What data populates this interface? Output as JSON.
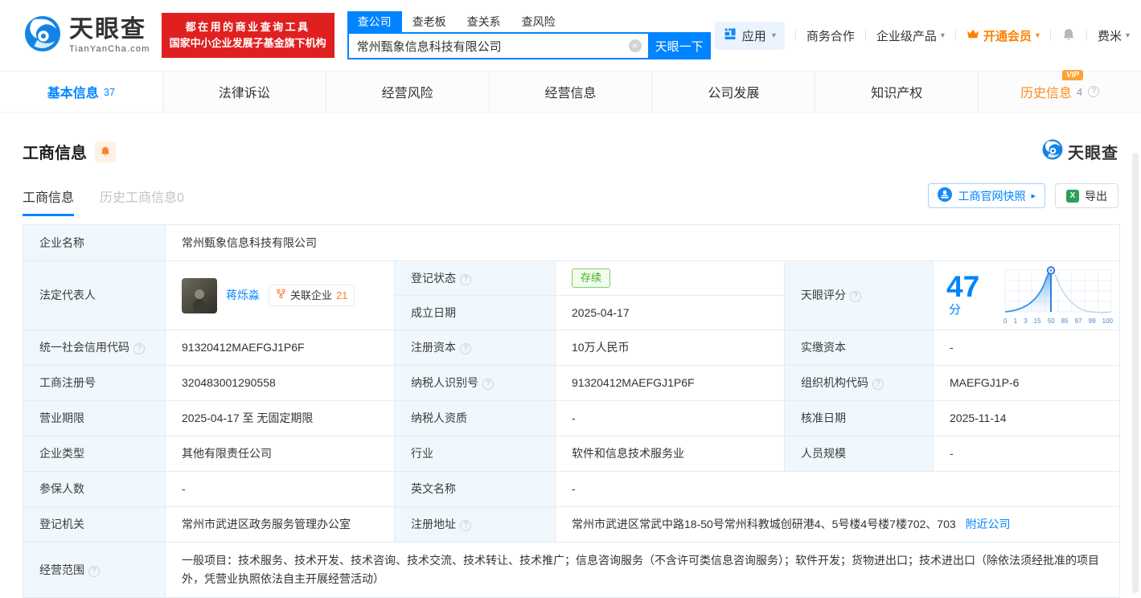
{
  "colors": {
    "primary_blue": "#0084ff",
    "promo_red": "#e02020",
    "vip_orange": "#ff8000",
    "status_green": "#48ab22"
  },
  "icons": {
    "clear": "×",
    "caret": "▾",
    "arrow_right": "▸",
    "question": "?",
    "excel_x": "X"
  },
  "header": {
    "brand": "天眼查",
    "brand_domain": "TianYanCha.com",
    "promo_line1": "都在用的商业查询工具",
    "promo_line2": "国家中小企业发展子基金旗下机构",
    "search_tabs": [
      {
        "label": "查公司"
      },
      {
        "label": "查老板"
      },
      {
        "label": "查关系"
      },
      {
        "label": "查风险"
      }
    ],
    "search_value": "常州甄象信息科技有限公司",
    "search_button": "天眼一下",
    "nav_apps": "应用",
    "nav_cooperation": "商务合作",
    "nav_enterprise": "企业级产品",
    "nav_vip": "开通会员",
    "nav_user": "费米"
  },
  "tabs": {
    "basic": "基本信息",
    "basic_count": "37",
    "legal": "法律诉讼",
    "risk": "经营风险",
    "operation": "经营信息",
    "development": "公司发展",
    "ip": "知识产权",
    "history": "历史信息",
    "history_count": "4",
    "history_vip": "VIP"
  },
  "section": {
    "title": "工商信息",
    "brand": "天眼查",
    "subtab_current": "工商信息",
    "subtab_history": "历史工商信息0",
    "snapshot_button": "工商官网快照",
    "export_button": "导出"
  },
  "table": {
    "company_name_label": "企业名称",
    "company_name_value": "常州甄象信息科技有限公司",
    "legal_rep_label": "法定代表人",
    "legal_rep_name": "蒋烁淼",
    "related_label": "关联企业",
    "related_count": "21",
    "reg_status_label": "登记状态",
    "reg_status_value": "存续",
    "establish_label": "成立日期",
    "establish_value": "2025-04-17",
    "score_label": "天眼评分",
    "score_value": "47",
    "score_unit": "分",
    "score_axis": [
      "0",
      "1",
      "3",
      "15",
      "50",
      "85",
      "97",
      "99",
      "100"
    ],
    "credit_code_label": "统一社会信用代码",
    "credit_code_value": "91320412MAEFGJ1P6F",
    "reg_capital_label": "注册资本",
    "reg_capital_value": "10万人民币",
    "paid_capital_label": "实缴资本",
    "paid_capital_value": "-",
    "reg_no_label": "工商注册号",
    "reg_no_value": "320483001290558",
    "taxpayer_id_label": "纳税人识别号",
    "taxpayer_id_value": "91320412MAEFGJ1P6F",
    "org_code_label": "组织机构代码",
    "org_code_value": "MAEFGJ1P-6",
    "term_label": "营业期限",
    "term_value": "2025-04-17 至 无固定期限",
    "taxpayer_quality_label": "纳税人资质",
    "taxpayer_quality_value": "-",
    "approval_label": "核准日期",
    "approval_value": "2025-11-14",
    "type_label": "企业类型",
    "type_value": "其他有限责任公司",
    "industry_label": "行业",
    "industry_value": "软件和信息技术服务业",
    "staff_label": "人员规模",
    "staff_value": "-",
    "insured_label": "参保人数",
    "insured_value": "-",
    "english_label": "英文名称",
    "english_value": "-",
    "authority_label": "登记机关",
    "authority_value": "常州市武进区政务服务管理办公室",
    "address_label": "注册地址",
    "address_value": "常州市武进区常武中路18-50号常州科教城创研港4、5号楼4号楼7楼702、703",
    "address_link": "附近公司",
    "scope_label": "经营范围",
    "scope_value": "一般项目：技术服务、技术开发、技术咨询、技术交流、技术转让、技术推广；信息咨询服务（不含许可类信息咨询服务）；软件开发；货物进出口；技术进出口（除依法须经批准的项目外，凭营业执照依法自主开展经营活动）"
  }
}
